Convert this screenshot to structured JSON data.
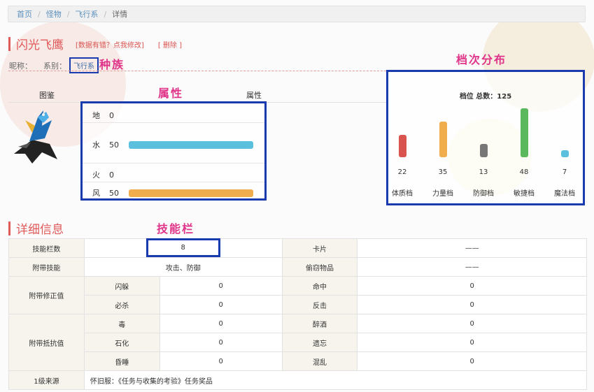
{
  "breadcrumb": [
    "首页",
    "怪物",
    "飞行系",
    "详情"
  ],
  "monster": {
    "name": "闪光飞鹰",
    "link_report": "[数据有错？点我修改]",
    "link_delete": "[ 删除 ]",
    "nick_label": "昵称：",
    "race_label": "系别：",
    "race_value": "飞行系"
  },
  "annotations": {
    "race": "种族",
    "attrs": "属性",
    "grade": "档次分布",
    "skill": "技能栏"
  },
  "headers": {
    "image": "图鉴",
    "attrs": "属性"
  },
  "attributes": [
    {
      "name": "地",
      "value": "0",
      "level": 0,
      "color": "#5bc0de"
    },
    {
      "name": "水",
      "value": "50",
      "level": 1.0,
      "color": "#5bc0de"
    },
    {
      "name": "火",
      "value": "0",
      "level": 0,
      "color": "#f0ad4e"
    },
    {
      "name": "风",
      "value": "50",
      "level": 1.0,
      "color": "#f0ad4e"
    }
  ],
  "grades": {
    "total_text": "档位 总数：125",
    "items": [
      {
        "label": "体质档",
        "value": "22",
        "num": 22,
        "color": "#d9534f"
      },
      {
        "label": "力量档",
        "value": "35",
        "num": 35,
        "color": "#f0ad4e"
      },
      {
        "label": "防御档",
        "value": "13",
        "num": 13,
        "color": "#777777"
      },
      {
        "label": "敏捷档",
        "value": "48",
        "num": 48,
        "color": "#5cb85c"
      },
      {
        "label": "魔法档",
        "value": "7",
        "num": 7,
        "color": "#5bc0de"
      }
    ]
  },
  "detail": {
    "title": "详细信息",
    "skill_slots_label": "技能栏数",
    "skill_slots_value": "8",
    "card_label": "卡片",
    "card_value": "——",
    "skills_label": "附带技能",
    "skills_value": "攻击、防御",
    "steal_label": "偷窃物品",
    "steal_value": "——",
    "correction_label": "附带修正值",
    "correction": [
      {
        "a_name": "闪躲",
        "a_val": "0",
        "b_name": "命中",
        "b_val": "0"
      },
      {
        "a_name": "必杀",
        "a_val": "0",
        "b_name": "反击",
        "b_val": "0"
      }
    ],
    "resist_label": "附带抵抗值",
    "resist": [
      {
        "a_name": "毒",
        "a_val": "0",
        "b_name": "醉酒",
        "b_val": "0"
      },
      {
        "a_name": "石化",
        "a_val": "0",
        "b_name": "遗忘",
        "b_val": "0"
      },
      {
        "a_name": "昏睡",
        "a_val": "0",
        "b_name": "混乱",
        "b_val": "0"
      }
    ],
    "source_label": "1级来源",
    "source_value": "怀旧服：《任务与收集的考验》任务奖品"
  }
}
